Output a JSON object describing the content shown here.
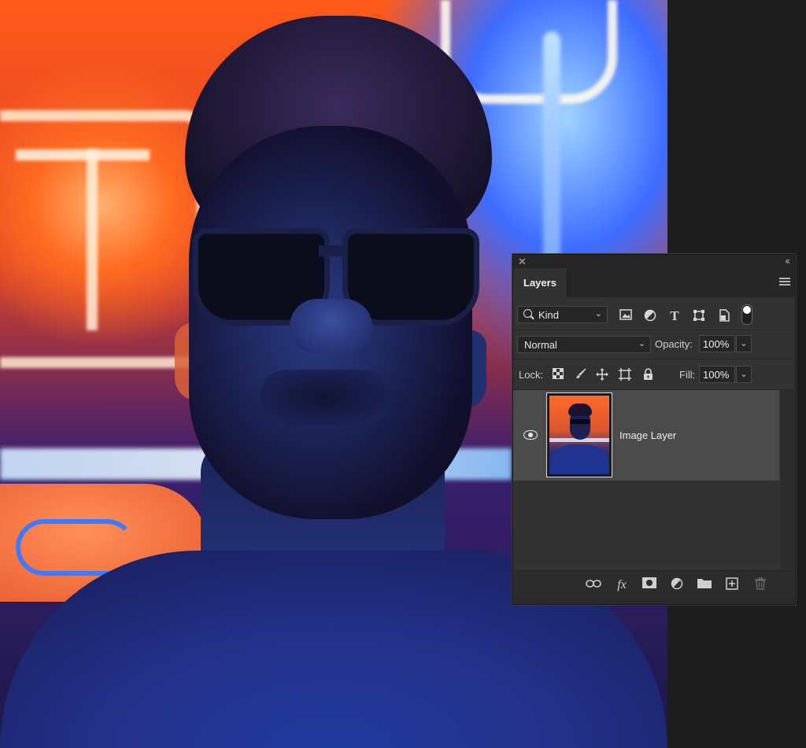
{
  "panel": {
    "tab_title": "Layers",
    "close_glyph": "✕",
    "collapse_glyph": "‹‹"
  },
  "filter": {
    "kind_label": "Kind",
    "icons": [
      "image-filter-icon",
      "adjustment-filter-icon",
      "type-filter-icon",
      "shape-filter-icon",
      "smart-object-filter-icon",
      "filter-toggle-switch"
    ]
  },
  "blend": {
    "mode": "Normal",
    "opacity_label": "Opacity:",
    "opacity_value": "100%"
  },
  "lock": {
    "label": "Lock:",
    "fill_label": "Fill:",
    "fill_value": "100%"
  },
  "layers": [
    {
      "name": "Image Layer",
      "visible": true
    }
  ],
  "footer_icons": [
    "link-layers-icon",
    "fx-icon",
    "mask-icon",
    "adjustment-layer-icon",
    "group-folder-icon",
    "new-layer-icon",
    "delete-icon"
  ]
}
